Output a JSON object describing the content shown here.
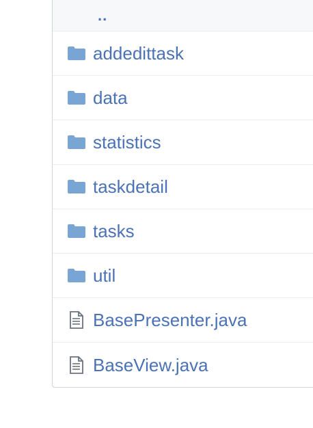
{
  "parent_link": {
    "label": ".."
  },
  "entries": [
    {
      "type": "folder",
      "icon": "folder-icon",
      "name": "addedittask"
    },
    {
      "type": "folder",
      "icon": "folder-icon",
      "name": "data"
    },
    {
      "type": "folder",
      "icon": "folder-icon",
      "name": "statistics"
    },
    {
      "type": "folder",
      "icon": "folder-icon",
      "name": "taskdetail"
    },
    {
      "type": "folder",
      "icon": "folder-icon",
      "name": "tasks"
    },
    {
      "type": "folder",
      "icon": "folder-icon",
      "name": "util"
    },
    {
      "type": "file",
      "icon": "file-icon",
      "name": "BasePresenter.java"
    },
    {
      "type": "file",
      "icon": "file-icon",
      "name": "BaseView.java"
    }
  ],
  "colors": {
    "link": "#4a72b5",
    "folder_icon": "#79a5d4",
    "file_icon": "#6a737d",
    "border": "#d1d5da",
    "header_bg": "#f6f8fa"
  }
}
